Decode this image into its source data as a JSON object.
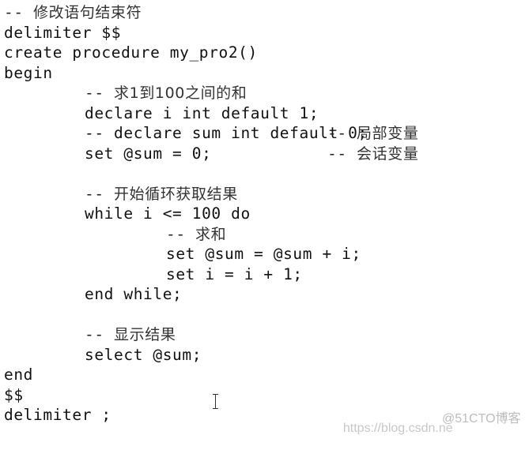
{
  "code": {
    "lines": [
      {
        "kind": "comment",
        "prefix": "-- ",
        "text": "修改语句结束符"
      },
      {
        "kind": "code",
        "text": "delimiter $$"
      },
      {
        "kind": "code",
        "text": "create procedure my_pro2()"
      },
      {
        "kind": "code",
        "text": "begin"
      },
      {
        "kind": "comment",
        "indent": 1,
        "prefix": "-- ",
        "text": "求1到100之间的和"
      },
      {
        "kind": "code",
        "indent": 1,
        "text": "declare i int default 1;"
      },
      {
        "kind": "code",
        "indent": 1,
        "text": "-- declare sum int default 0;",
        "trailing_comment": "局部变量"
      },
      {
        "kind": "code",
        "indent": 1,
        "text": "set @sum = 0;",
        "trailing_comment": "会话变量"
      },
      {
        "kind": "blank"
      },
      {
        "kind": "comment",
        "indent": 1,
        "prefix": "-- ",
        "text": "开始循环获取结果"
      },
      {
        "kind": "code",
        "indent": 1,
        "text": "while i <= 100 do"
      },
      {
        "kind": "comment",
        "indent": 2,
        "prefix": "-- ",
        "text": "求和"
      },
      {
        "kind": "code",
        "indent": 2,
        "text": "set @sum = @sum + i;"
      },
      {
        "kind": "code",
        "indent": 2,
        "text": "set i = i + 1;"
      },
      {
        "kind": "code",
        "indent": 1,
        "text": "end while;"
      },
      {
        "kind": "blank"
      },
      {
        "kind": "comment",
        "indent": 1,
        "prefix": "-- ",
        "text": "显示结果"
      },
      {
        "kind": "code",
        "indent": 1,
        "text": "select @sum;"
      },
      {
        "kind": "code",
        "text": "end"
      },
      {
        "kind": "code",
        "text": "$$"
      },
      {
        "kind": "code",
        "text": "delimiter ;"
      }
    ],
    "comment_marker": "-- "
  },
  "cursor": {
    "icon": "text-ibeam-cursor-icon"
  },
  "watermark": {
    "url_text": "https://blog.csdn.ne",
    "brand_text": "@51CTO博客"
  }
}
